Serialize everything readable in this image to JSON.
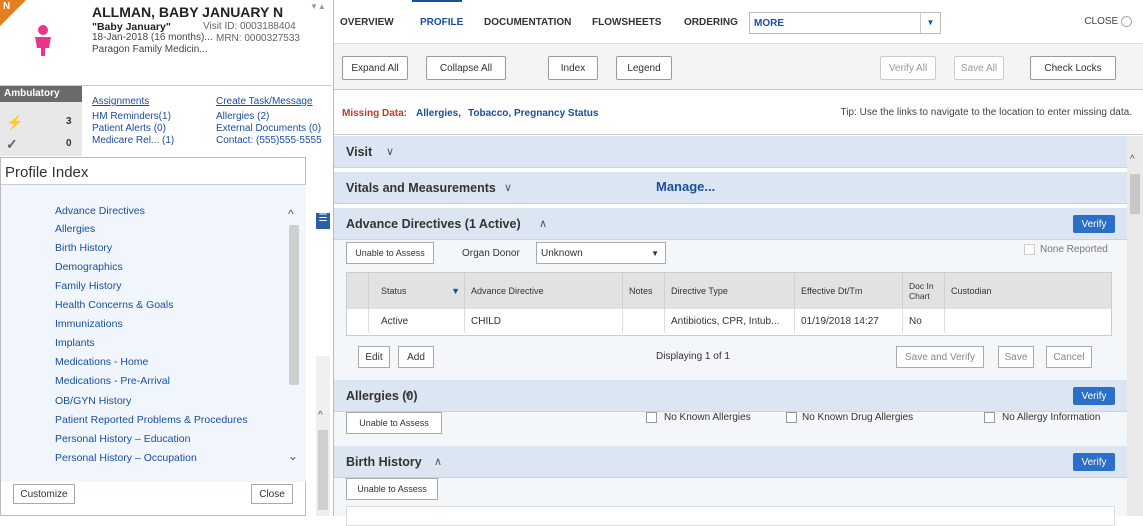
{
  "patient": {
    "name": "ALLMAN, BABY JANUARY N",
    "alias": "\"Baby January\"",
    "visit_id": "Visit ID: 0003188404",
    "dob": "18-Jan-2018 (16 months)...",
    "mrn": "MRN: 0000327533",
    "clinic": "Paragon Family Medicin...",
    "badge": "N"
  },
  "strip": {
    "label": "Ambulatory",
    "rows": [
      {
        "count": "3"
      },
      {
        "count": "0"
      }
    ]
  },
  "patient_links": {
    "assignments": "Assignments",
    "create_task": "Create Task/Message",
    "hm_reminders": "HM Reminders(1)",
    "allergies": "Allergies (2)",
    "patient_alerts": "Patient Alerts (0)",
    "external_docs": "External Documents (0)",
    "medicare": "Medicare Rel... (1)",
    "contact": "Contact: (555)555-5555"
  },
  "profile_index": {
    "title": "Profile Index",
    "items": [
      "Advance Directives",
      "Allergies",
      "Birth History",
      "Demographics",
      "Family History",
      "Health Concerns & Goals",
      "Immunizations",
      "Implants",
      "Medications - Home",
      "Medications - Pre-Arrival",
      "OB/GYN History",
      "Patient Reported Problems & Procedures",
      "Personal History – Education",
      "Personal History – Occupation"
    ],
    "customize": "Customize",
    "close": "Close"
  },
  "tabs": [
    "OVERVIEW",
    "PROFILE",
    "DOCUMENTATION",
    "FLOWSHEETS",
    "ORDERING"
  ],
  "more_label": "MORE",
  "close_label": "CLOSE",
  "toolbar": {
    "expand_all": "Expand All",
    "collapse_all": "Collapse All",
    "index": "Index",
    "legend": "Legend",
    "verify_all": "Verify All",
    "save_all": "Save All",
    "check_locks": "Check Locks"
  },
  "missing": {
    "label": "Missing Data:",
    "links": [
      "Allergies,",
      "Tobacco,",
      "Pregnancy Status"
    ],
    "tip": "Tip: Use the links to navigate to the location to enter missing data."
  },
  "sections": {
    "visit": "Visit",
    "vitals": "Vitals and Measurements",
    "manage": "Manage...",
    "advance_directives": "Advance Directives (1 Active)",
    "allergies": "Allergies (0)",
    "birth_history": "Birth History",
    "verify": "Verify",
    "unable_to_assess": "Unable to Assess"
  },
  "advance_directives": {
    "organ_donor_label": "Organ Donor",
    "organ_donor_value": "Unknown",
    "none_reported": "None Reported",
    "columns": [
      "Status",
      "Advance Directive",
      "Notes",
      "Directive Type",
      "Effective Dt/Tm",
      "Doc In Chart",
      "Custodian"
    ],
    "rows": [
      [
        "Active",
        "CHILD",
        "",
        "Antibiotics, CPR, Intub...",
        "01/19/2018 14:27",
        "No",
        ""
      ]
    ],
    "edit": "Edit",
    "add": "Add",
    "displaying": "Displaying 1 of 1",
    "save_verify": "Save and Verify",
    "save": "Save",
    "cancel": "Cancel"
  },
  "allergies_opts": [
    "No Known Allergies",
    "No Known Drug Allergies",
    "No Allergy Information"
  ],
  "colors": {
    "accent": "#1a4fa0",
    "verify": "#2c6fc8",
    "missing": "#c0392b",
    "section": "#dbe6f2"
  }
}
